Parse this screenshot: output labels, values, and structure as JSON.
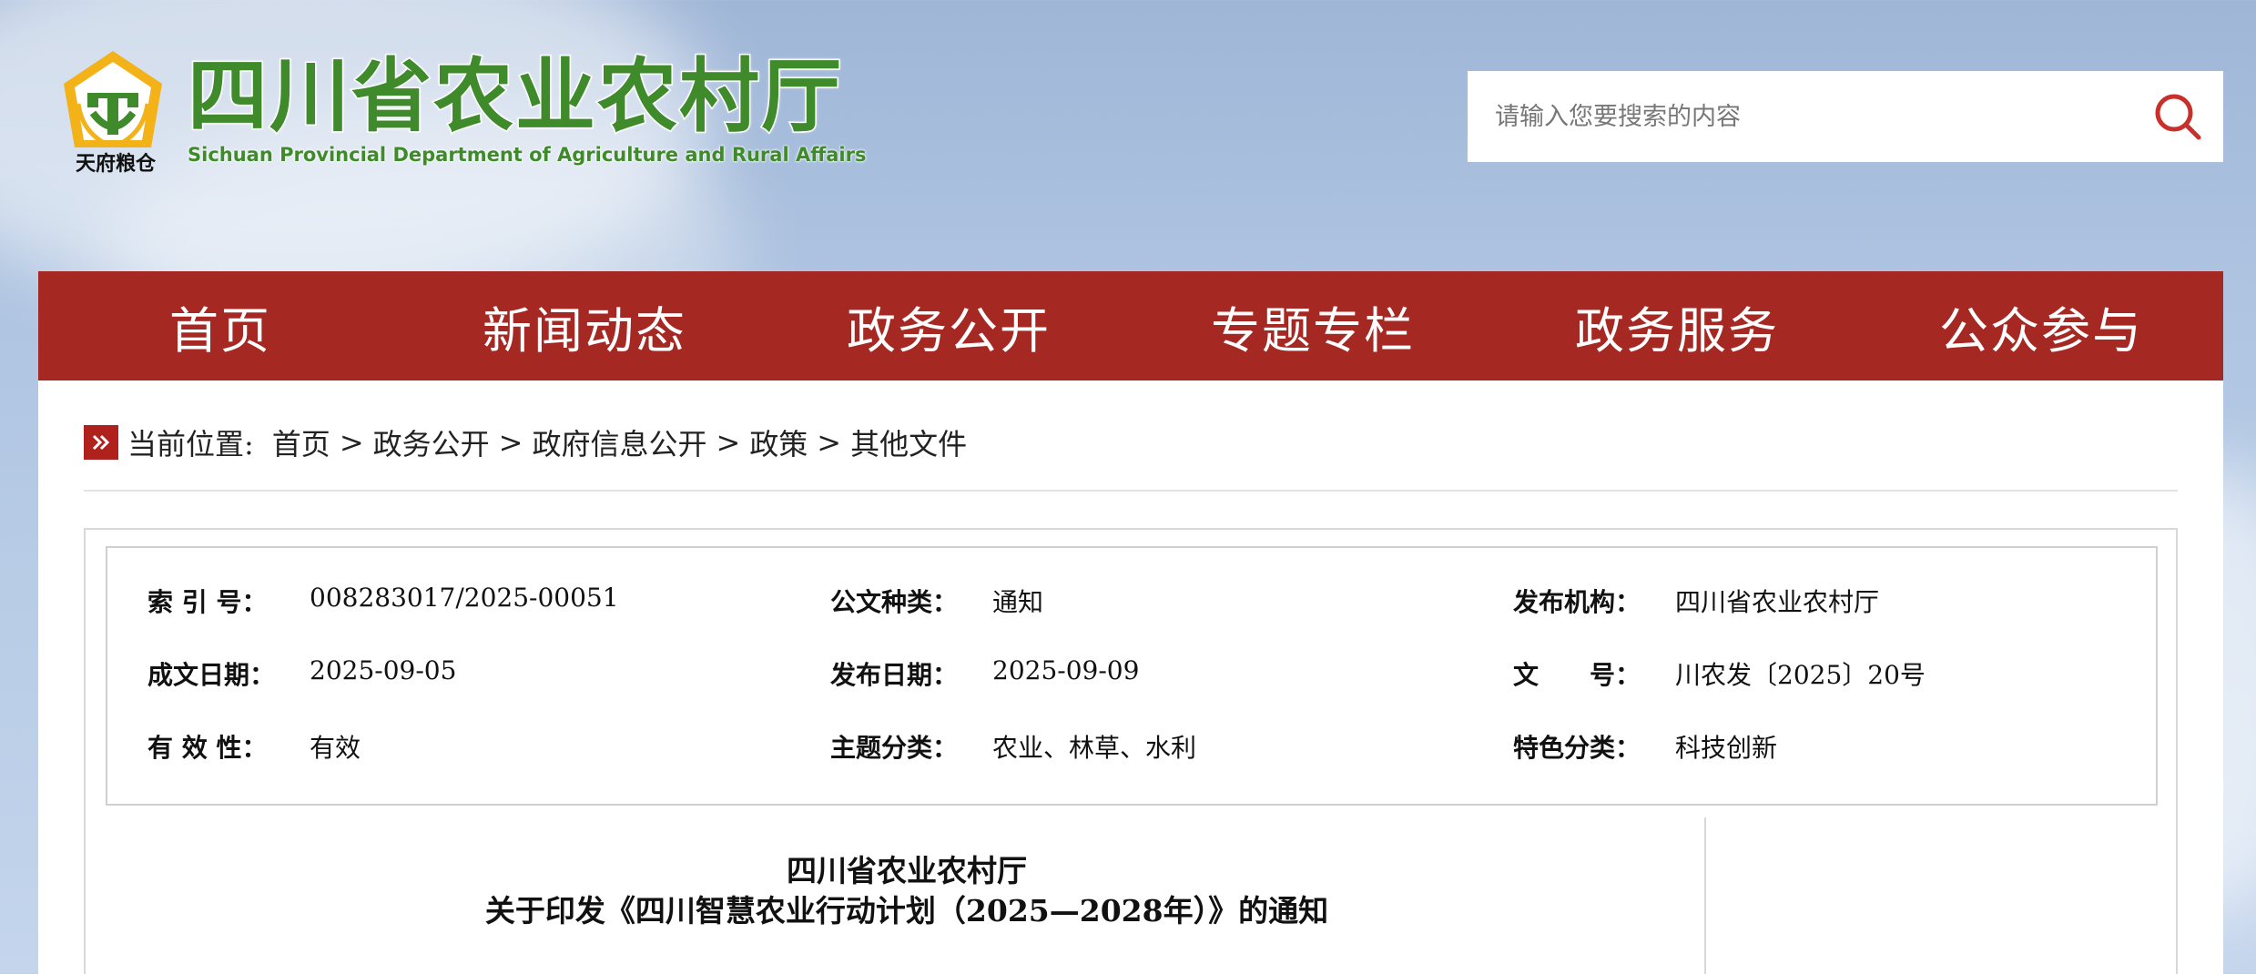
{
  "header": {
    "logo_title": "四川省农业农村厅",
    "logo_subtitle": "Sichuan Provincial Department of Agriculture and Rural Affairs",
    "emblem_text": "天府粮仓",
    "search": {
      "placeholder": "请输入您要搜索的内容",
      "icon": "search-icon"
    }
  },
  "nav": {
    "items": [
      "首页",
      "新闻动态",
      "政务公开",
      "专题专栏",
      "政务服务",
      "公众参与"
    ]
  },
  "breadcrumb": {
    "prefix": "当前位置:",
    "items": [
      "首页",
      "政务公开",
      "政府信息公开",
      "政策",
      "其他文件"
    ],
    "separator": ">"
  },
  "meta": {
    "index_no": {
      "label": "索 引 号：",
      "value": "008283017/2025-00051"
    },
    "doc_type": {
      "label": "公文种类：",
      "value": "通知"
    },
    "publisher": {
      "label": "发布机构：",
      "value": "四川省农业农村厅"
    },
    "created_date": {
      "label": "成文日期：",
      "value": "2025-09-05"
    },
    "publish_date": {
      "label": "发布日期：",
      "value": "2025-09-09"
    },
    "doc_no": {
      "label": "文　　号：",
      "value": "川农发〔2025〕20号"
    },
    "validity": {
      "label": "有 效 性：",
      "value": "有效"
    },
    "topic": {
      "label": "主题分类：",
      "value": "农业、林草、水利"
    },
    "feature": {
      "label": "特色分类：",
      "value": "科技创新"
    }
  },
  "article": {
    "issuer": "四川省农业农村厅",
    "title": "关于印发《四川智慧农业行动计划（2025—2028年）》的通知"
  },
  "colors": {
    "nav_bg": "#a52823",
    "brand_green": "#3f8a2a",
    "accent_red": "#b0211e"
  }
}
